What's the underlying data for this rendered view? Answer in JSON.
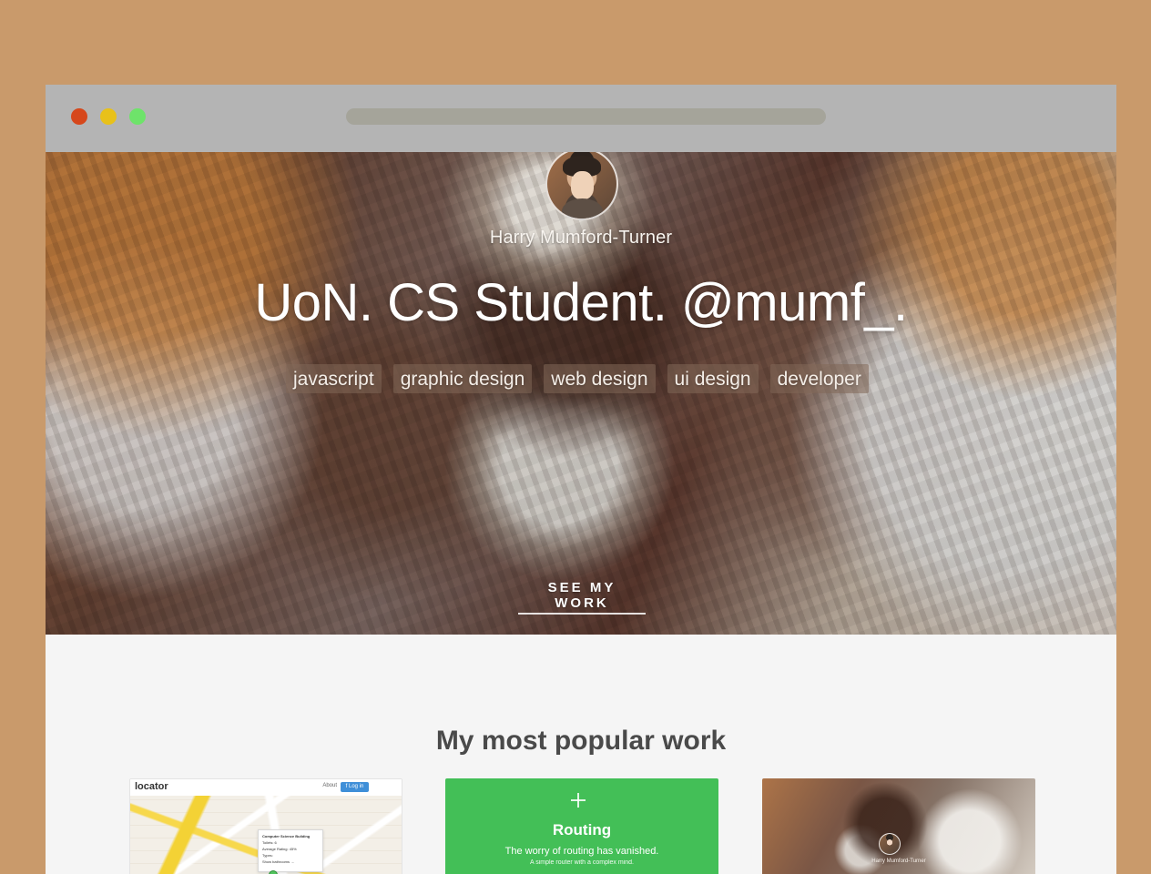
{
  "window": {
    "traffic_lights": [
      {
        "name": "close",
        "color": "#d6471b"
      },
      {
        "name": "minimize",
        "color": "#e8c11a"
      },
      {
        "name": "maximize",
        "color": "#6ee36a"
      }
    ]
  },
  "hero": {
    "name": "Harry Mumford-Turner",
    "headline": "UoN. CS Student. @mumf_.",
    "tags": [
      "javascript",
      "graphic design",
      "web design",
      "ui design",
      "developer"
    ],
    "cta": "SEE MY WORK"
  },
  "popular": {
    "title": "My most popular work",
    "cards": [
      {
        "brand": "locator",
        "about": "About",
        "login": "f Log in",
        "popup": {
          "title": "Computer Science Building",
          "line1": "Toilets: 6",
          "line2": "Average Rating: 45%",
          "line3": "Types:",
          "line4": "Show bathrooms →"
        }
      },
      {
        "title": "Routing",
        "line1": "The worry of routing has vanished.",
        "line2": "A simple router with a complex mind."
      },
      {
        "name": "Harry Mumford-Turner"
      }
    ]
  },
  "colors": {
    "background": "#c99a6b",
    "titlebar": "#b4b4b4",
    "address_bar": "#a5a49a",
    "content_background": "#f5f5f5",
    "routing_green": "#43bf57",
    "login_blue": "#3f8fd8"
  }
}
